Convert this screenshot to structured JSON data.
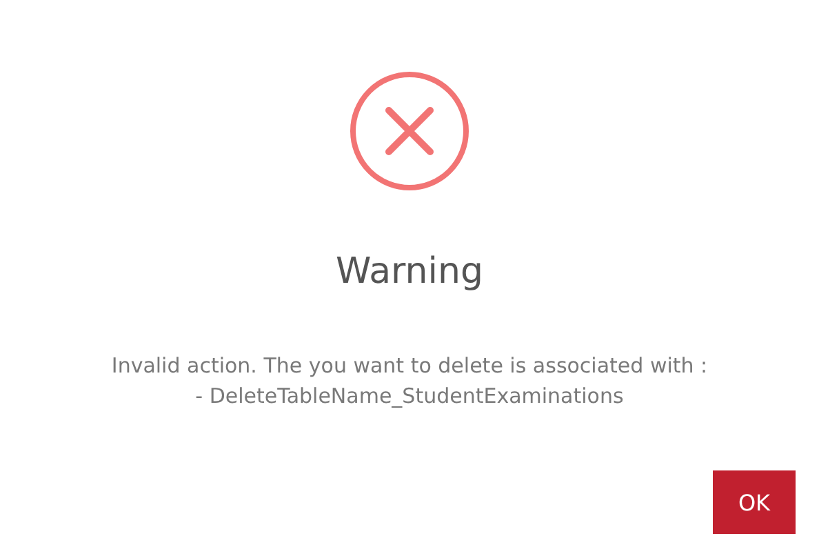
{
  "dialog": {
    "title": "Warning",
    "message_lines": [
      "Invalid action. The you want to delete is associated with :",
      "- DeleteTableName_StudentExaminations"
    ],
    "buttons": [
      {
        "label": "OK"
      }
    ]
  }
}
